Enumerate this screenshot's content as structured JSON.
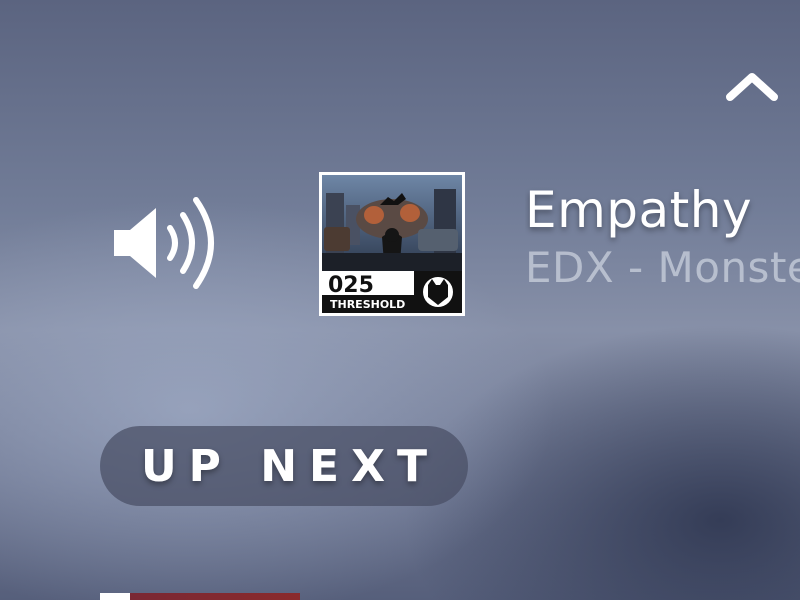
{
  "header": {
    "collapse_icon": "chevron-up-icon"
  },
  "player": {
    "volume_icon": "speaker-volume-icon",
    "album_art": {
      "number": "025",
      "label": "THRESHOLD"
    },
    "track": {
      "title": "Empathy",
      "artist": "EDX - Monste"
    }
  },
  "queue": {
    "up_next_label": "UP NEXT"
  },
  "colors": {
    "text_primary": "#ffffff",
    "text_secondary": "#c9cfdc",
    "pill_background": "#484e64"
  }
}
